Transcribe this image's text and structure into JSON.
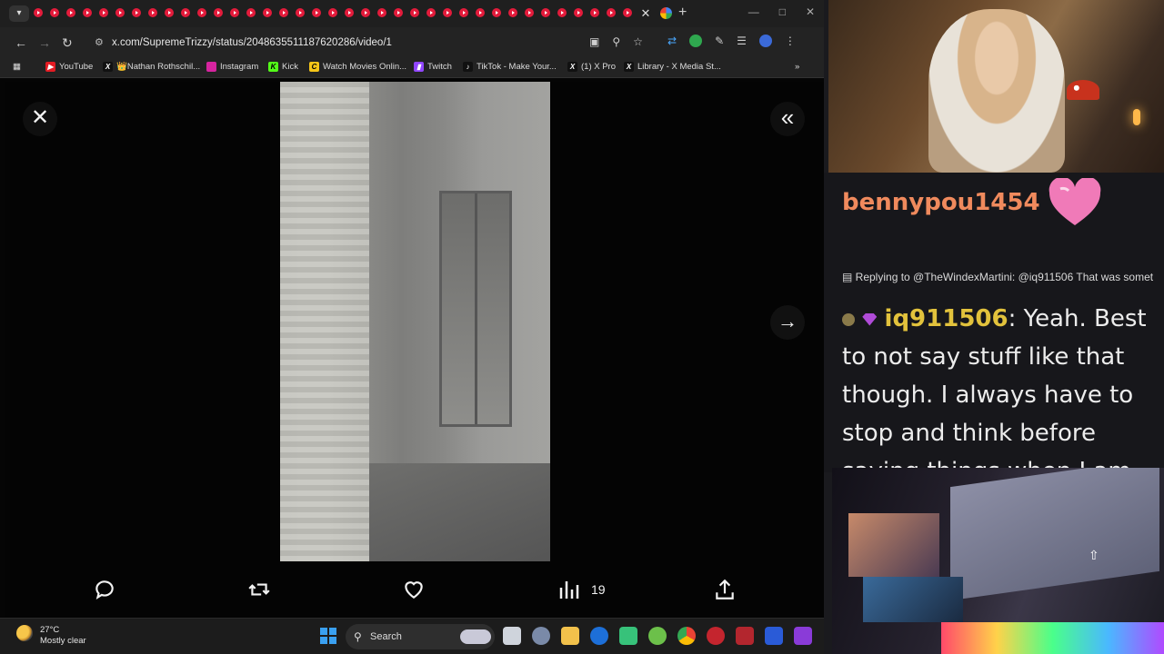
{
  "browser": {
    "url": "x.com/SupremeTrizzy/status/2048635511187620286/video/1",
    "bookmarks": [
      {
        "label": "YouTube",
        "icon": "youtube-icon",
        "color": "#e31b23"
      },
      {
        "label": "👑Nathan Rothschil...",
        "icon": "x-icon",
        "color": "#111111"
      },
      {
        "label": "Instagram",
        "icon": "instagram-icon",
        "color": "#d6249f"
      },
      {
        "label": "Kick",
        "icon": "kick-icon",
        "color": "#53fc18"
      },
      {
        "label": "Watch Movies Onlin...",
        "icon": "movies-icon",
        "color": "#f5c518"
      },
      {
        "label": "Twitch",
        "icon": "twitch-icon",
        "color": "#9146ff"
      },
      {
        "label": "TikTok - Make Your...",
        "icon": "tiktok-icon",
        "color": "#111111"
      },
      {
        "label": "(1) X Pro",
        "icon": "x-icon",
        "color": "#111111"
      },
      {
        "label": "Library - X Media St...",
        "icon": "x-icon",
        "color": "#111111"
      }
    ]
  },
  "viewer": {
    "views_count": "19"
  },
  "taskbar": {
    "temperature": "27°C",
    "condition": "Mostly clear",
    "search_label": "Search"
  },
  "chat": {
    "featured_user": "bennypou1454",
    "reply_text": "Replying to @TheWindexMartini: @iq911506 That was somet",
    "message_user": "iq911506",
    "message_text": ": Yeah. Best to not say stuff like that though. I always have to stop and think before saying things when I am"
  },
  "colors": {
    "accent_username": "#f08a5d",
    "chat_name": "#e2c23c"
  }
}
